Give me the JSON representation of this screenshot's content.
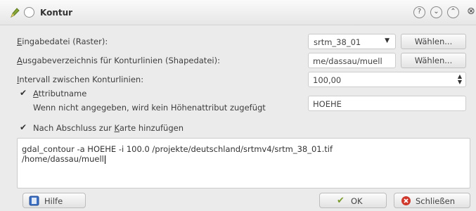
{
  "window": {
    "title": "Kontur"
  },
  "form": {
    "input_label_prefix": "E",
    "input_label_rest": "ingabedatei (Raster):",
    "input_value": "srtm_38_01",
    "input_browse": "Wählen...",
    "output_label_prefix": "A",
    "output_label_rest": "usgabeverzeichnis für Konturlinien (Shapedatei):",
    "output_value": "me/dassau/muell",
    "output_browse": "Wählen...",
    "interval_label_prefix": "I",
    "interval_label_rest": "ntervall zwischen Konturlinien:",
    "interval_value": "100,00",
    "attr_label_prefix": "A",
    "attr_label_rest": "ttributname",
    "attr_hint": "Wenn nicht angegeben, wird kein Höhenattribut zugefügt",
    "attr_value": "HOEHE",
    "add_to_map_label_prefix": "Nach Abschluss zur ",
    "add_to_map_label_key": "K",
    "add_to_map_label_rest": "arte hinzufügen",
    "command_line1": "gdal_contour -a HOEHE -i 100.0 /projekte/deutschland/srtmv4/srtm_38_01.tif",
    "command_line2": "/home/dassau/muell"
  },
  "buttons": {
    "help": "Hilfe",
    "ok": "OK",
    "close": "Schließen"
  },
  "colors": {
    "accent_green": "#7a9c2e",
    "close_red": "#d0382c",
    "help_blue": "#3b6fc3"
  }
}
